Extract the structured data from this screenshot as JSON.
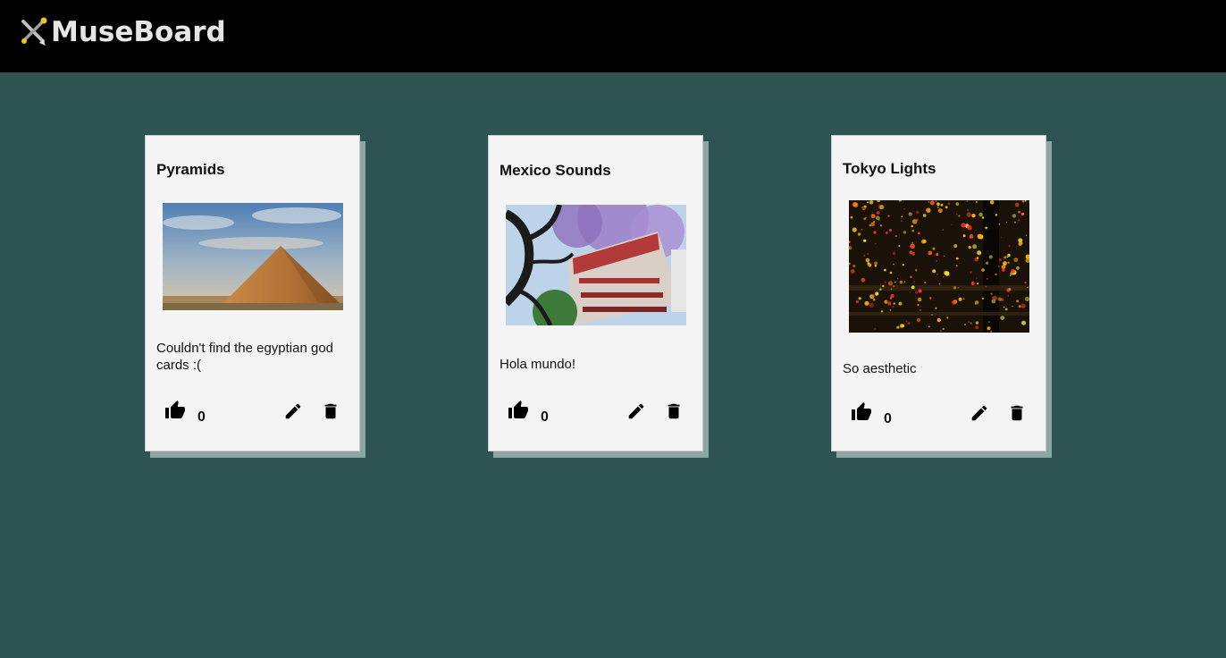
{
  "app": {
    "name": "MuseBoard",
    "logo_icon": "pen-brush-crossed-icon"
  },
  "colors": {
    "background": "#2d5352",
    "header": "#000000",
    "card": "#f4f4f4",
    "card_shadow": "#8fa5a3"
  },
  "cards": [
    {
      "title": "Pyramids",
      "description": "Couldn't find the egyptian god cards :(",
      "likes": "0",
      "image": "pyramid-photo"
    },
    {
      "title": "Mexico Sounds",
      "description": "Hola mundo!",
      "likes": "0",
      "image": "jacaranda-building-photo"
    },
    {
      "title": "Tokyo Lights",
      "description": "So aesthetic",
      "likes": "0",
      "image": "infinity-lights-photo"
    }
  ],
  "icons": {
    "like": "thumb-up-icon",
    "edit": "pencil-icon",
    "delete": "trash-icon"
  }
}
